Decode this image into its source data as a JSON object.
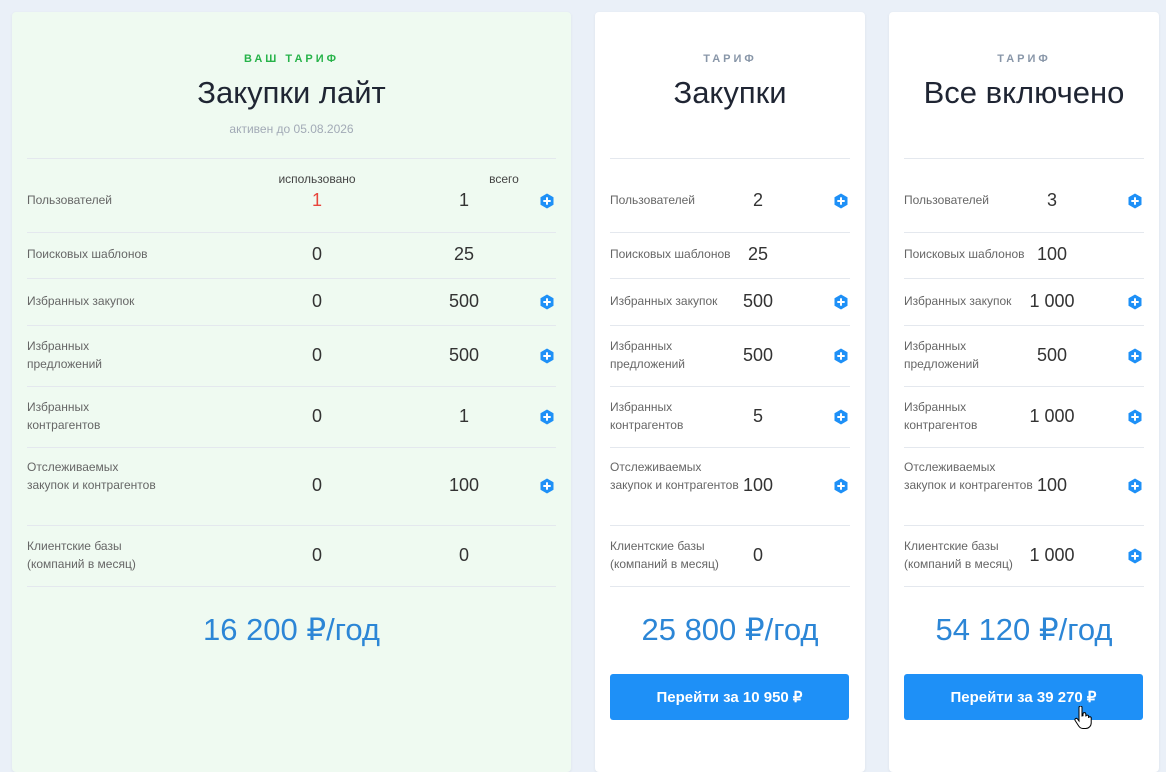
{
  "colors": {
    "accent": "#1e90f7",
    "price": "#2c86d6",
    "current_label": "#27b34a",
    "used_over": "#e8453c"
  },
  "columns": {
    "used": "использовано",
    "total": "всего"
  },
  "row_labels": [
    "Пользователей",
    "Поисковых шаблонов",
    "Избранных закупок",
    "Избранных предложений",
    "Избранных контрагентов",
    "Отслеживаемых закупок и контрагентов",
    "Клиентские базы (компаний в месяц)"
  ],
  "plans": [
    {
      "label": "ВАШ ТАРИФ",
      "title": "Закупки лайт",
      "subtitle": "активен до 05.08.2026",
      "used": [
        "1",
        "0",
        "0",
        "0",
        "0",
        "0",
        "0"
      ],
      "total": [
        "1",
        "25",
        "500",
        "500",
        "1",
        "100",
        "0"
      ],
      "addable": [
        true,
        false,
        true,
        true,
        true,
        true,
        false
      ],
      "price": "16 200 ₽/год",
      "button": ""
    },
    {
      "label": "ТАРИФ",
      "title": "Закупки",
      "subtitle": "",
      "total": [
        "2",
        "25",
        "500",
        "500",
        "5",
        "100",
        "0"
      ],
      "addable": [
        true,
        false,
        true,
        true,
        true,
        true,
        false
      ],
      "price": "25 800 ₽/год",
      "button": "Перейти за 10 950 ₽"
    },
    {
      "label": "ТАРИФ",
      "title": "Все включено",
      "subtitle": "",
      "total": [
        "3",
        "100",
        "1 000",
        "500",
        "1 000",
        "100",
        "1 000"
      ],
      "addable": [
        true,
        false,
        true,
        true,
        true,
        true,
        true
      ],
      "price": "54 120 ₽/год",
      "button": "Перейти за 39 270 ₽"
    }
  ]
}
